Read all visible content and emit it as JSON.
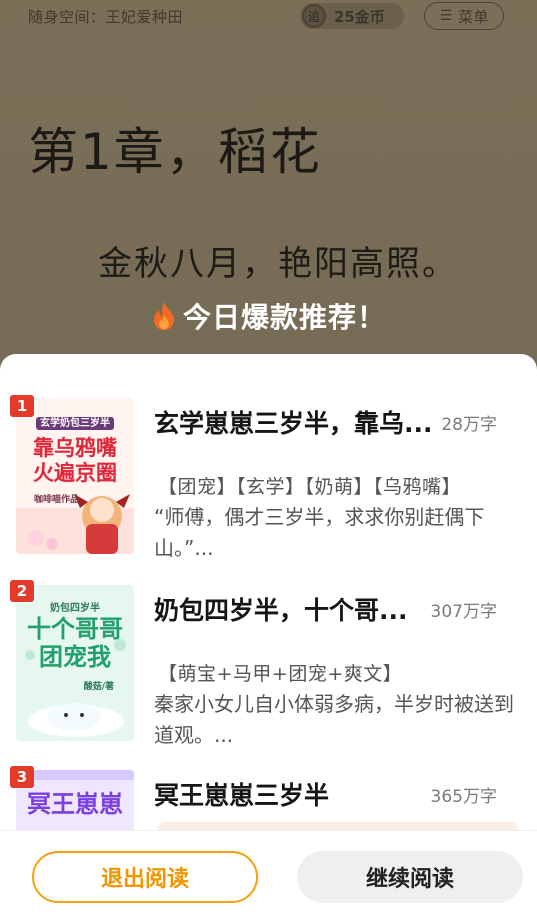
{
  "reader": {
    "book_label": "随身空间：王妃爱种田",
    "coin_icon": "追",
    "coins": "25金币",
    "menu_label": "菜单",
    "chapter_title": "第1章，稻花",
    "body_text": "金秋八月，艳阳高照。"
  },
  "promo": {
    "title": "今日爆款推荐！",
    "books": [
      {
        "rank": "1",
        "title": "玄学崽崽三岁半，靠乌...",
        "word_count": "28万字",
        "tags": "【团宠】【玄学】【奶萌】【乌鸦嘴】",
        "desc": "“师傅，偶才三岁半，求求你别赶偶下山。”...",
        "cover_top": "玄学奶包三岁半",
        "cover_main": "靠乌鸦嘴\n火遍京圈",
        "cover_author": "咖啡喵作品"
      },
      {
        "rank": "2",
        "title": "奶包四岁半，十个哥...",
        "word_count": "307万字",
        "tags": "【萌宝+马甲+团宠+爽文】",
        "desc": "秦家小女儿自小体弱多病，半岁时被送到道观。...",
        "cover_top": "奶包四岁半",
        "cover_main": "十个哥哥\n团宠我",
        "cover_author": "酸菇/著"
      },
      {
        "rank": "3",
        "title": "冥王崽崽三岁半",
        "word_count": "365万字",
        "tags": "",
        "desc": "",
        "cover_top": "",
        "cover_main": "冥王崽崽",
        "cover_author": ""
      }
    ]
  },
  "actions": {
    "exit_label": "退出阅读",
    "continue_label": "继续阅读"
  }
}
